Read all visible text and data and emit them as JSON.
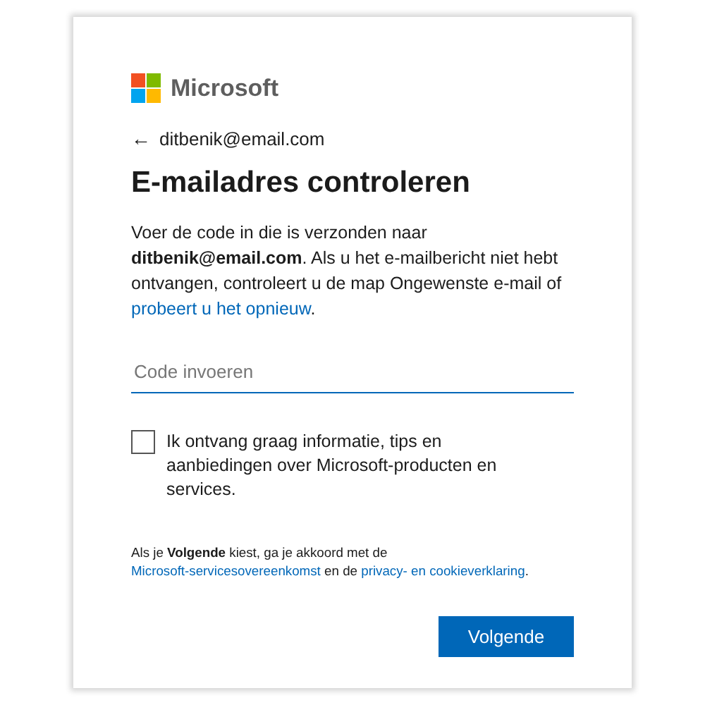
{
  "brand": "Microsoft",
  "back": {
    "icon": "←",
    "email": "ditbenik@email.com"
  },
  "title": "E-mailadres controleren",
  "description": {
    "text": "Voer de code in die is verzonden naar **ditbenik@email.com**. Als u het e-mailbericht niet hebt ontvangen, controleert u de map Ongewenste e-mail of",
    "link": "probeert u het opnieuw",
    "end": "."
  },
  "code_field": {
    "placeholder": "Code invoeren"
  },
  "consent": {
    "checked": false,
    "label": "Ik ontvang graag informatie, tips en aanbiedingen over Microsoft-producten en services."
  },
  "legal": {
    "text": "Als je **Volgende** kiest, ga je akkoord met de",
    "link_1": "Microsoft-servicesovereenkomst",
    "middle": "en de",
    "link_2": "privacy- en cookieverklaring",
    "end": "."
  },
  "buttons": [
    {
      "label": "Volgende",
      "kind": "primary"
    }
  ]
}
